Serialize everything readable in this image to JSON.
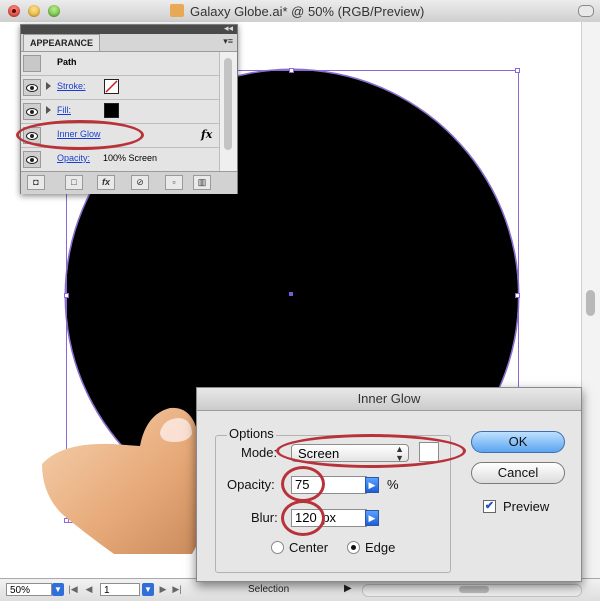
{
  "window": {
    "title": "Galaxy Globe.ai* @ 50% (RGB/Preview)"
  },
  "appearance_panel": {
    "tab": "APPEARANCE",
    "header": "Path",
    "rows": [
      {
        "label": "Stroke:"
      },
      {
        "label": "Fill:"
      },
      {
        "label": "Inner Glow",
        "fx": "fx"
      },
      {
        "label": "Opacity:",
        "value": "100% Screen"
      }
    ]
  },
  "dialog": {
    "title": "Inner Glow",
    "options_label": "Options",
    "mode_label": "Mode:",
    "mode_value": "Screen",
    "opacity_label": "Opacity:",
    "opacity_value": "75",
    "opacity_unit": "%",
    "blur_label": "Blur:",
    "blur_value": "120",
    "blur_unit": "px",
    "center_label": "Center",
    "edge_label": "Edge",
    "ok_label": "OK",
    "cancel_label": "Cancel",
    "preview_label": "Preview",
    "preview_checked": true,
    "selected_position": "Edge"
  },
  "status_bar": {
    "zoom": "50%",
    "page": "1",
    "tool": "Selection"
  },
  "colors": {
    "annotation": "#b8323a",
    "selection": "#8a6bd6",
    "link": "#1a3fd0"
  }
}
